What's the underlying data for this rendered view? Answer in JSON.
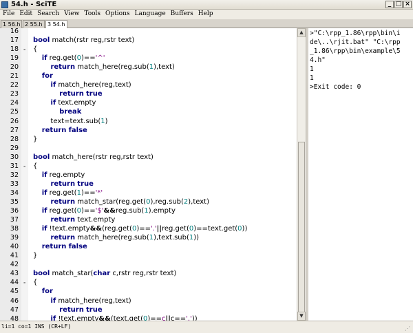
{
  "window": {
    "title": "54.h - SciTE",
    "min_glyph": "_",
    "max_glyph": "□",
    "close_glyph": "×"
  },
  "menu": [
    "File",
    "Edit",
    "Search",
    "View",
    "Tools",
    "Options",
    "Language",
    "Buffers",
    "Help"
  ],
  "tabs": [
    "1 56.h",
    "2 55.h",
    "3 54.h"
  ],
  "active_tab": 2,
  "editor": {
    "lines": [
      {
        "n": "16",
        "fold": "",
        "code": []
      },
      {
        "n": "17",
        "fold": "",
        "code": [
          [
            "kw",
            "bool"
          ],
          [
            "t",
            " match(rstr reg,rstr text)"
          ]
        ]
      },
      {
        "n": "18",
        "fold": "-",
        "code": [
          [
            "t",
            "{"
          ]
        ]
      },
      {
        "n": "19",
        "fold": "",
        "code": [
          [
            "t",
            "    "
          ],
          [
            "kw",
            "if"
          ],
          [
            "t",
            " reg.get("
          ],
          [
            "num",
            "0"
          ],
          [
            "t",
            ")=="
          ],
          [
            "str",
            "'^'"
          ]
        ]
      },
      {
        "n": "20",
        "fold": "",
        "code": [
          [
            "t",
            "        "
          ],
          [
            "kw",
            "return"
          ],
          [
            "t",
            " match_here(reg.sub("
          ],
          [
            "num",
            "1"
          ],
          [
            "t",
            "),text)"
          ]
        ]
      },
      {
        "n": "21",
        "fold": "",
        "code": [
          [
            "t",
            "    "
          ],
          [
            "kw",
            "for"
          ]
        ]
      },
      {
        "n": "22",
        "fold": "",
        "code": [
          [
            "t",
            "        "
          ],
          [
            "kw",
            "if"
          ],
          [
            "t",
            " match_here(reg,text)"
          ]
        ]
      },
      {
        "n": "23",
        "fold": "",
        "code": [
          [
            "t",
            "            "
          ],
          [
            "kw",
            "return"
          ],
          [
            "t",
            " "
          ],
          [
            "kw",
            "true"
          ]
        ]
      },
      {
        "n": "24",
        "fold": "",
        "code": [
          [
            "t",
            "        "
          ],
          [
            "kw",
            "if"
          ],
          [
            "t",
            " text.empty"
          ]
        ]
      },
      {
        "n": "25",
        "fold": "",
        "code": [
          [
            "t",
            "            "
          ],
          [
            "kw",
            "break"
          ]
        ]
      },
      {
        "n": "26",
        "fold": "",
        "code": [
          [
            "t",
            "        text=text.sub("
          ],
          [
            "num",
            "1"
          ],
          [
            "t",
            ")"
          ]
        ]
      },
      {
        "n": "27",
        "fold": "",
        "code": [
          [
            "t",
            "    "
          ],
          [
            "kw",
            "return"
          ],
          [
            "t",
            " "
          ],
          [
            "kw",
            "false"
          ]
        ]
      },
      {
        "n": "28",
        "fold": "",
        "code": [
          [
            "t",
            "}"
          ]
        ]
      },
      {
        "n": "29",
        "fold": "",
        "code": []
      },
      {
        "n": "30",
        "fold": "",
        "code": [
          [
            "kw",
            "bool"
          ],
          [
            "t",
            " match_here(rstr reg,rstr text)"
          ]
        ]
      },
      {
        "n": "31",
        "fold": "-",
        "code": [
          [
            "t",
            "{"
          ]
        ]
      },
      {
        "n": "32",
        "fold": "",
        "code": [
          [
            "t",
            "    "
          ],
          [
            "kw",
            "if"
          ],
          [
            "t",
            " reg.empty"
          ]
        ]
      },
      {
        "n": "33",
        "fold": "",
        "code": [
          [
            "t",
            "        "
          ],
          [
            "kw",
            "return"
          ],
          [
            "t",
            " "
          ],
          [
            "kw",
            "true"
          ]
        ]
      },
      {
        "n": "34",
        "fold": "",
        "code": [
          [
            "t",
            "    "
          ],
          [
            "kw",
            "if"
          ],
          [
            "t",
            " reg.get("
          ],
          [
            "num",
            "1"
          ],
          [
            "t",
            ")=="
          ],
          [
            "str",
            "'*'"
          ]
        ]
      },
      {
        "n": "35",
        "fold": "",
        "code": [
          [
            "t",
            "        "
          ],
          [
            "kw",
            "return"
          ],
          [
            "t",
            " match_star(reg.get("
          ],
          [
            "num",
            "0"
          ],
          [
            "t",
            "),reg.sub("
          ],
          [
            "num",
            "2"
          ],
          [
            "t",
            "),text)"
          ]
        ]
      },
      {
        "n": "36",
        "fold": "",
        "code": [
          [
            "t",
            "    "
          ],
          [
            "kw",
            "if"
          ],
          [
            "t",
            " reg.get("
          ],
          [
            "num",
            "0"
          ],
          [
            "t",
            ")=="
          ],
          [
            "str",
            "'$'"
          ],
          [
            "op",
            "&&"
          ],
          [
            "t",
            "reg.sub("
          ],
          [
            "num",
            "1"
          ],
          [
            "t",
            ").empty"
          ]
        ]
      },
      {
        "n": "37",
        "fold": "",
        "code": [
          [
            "t",
            "        "
          ],
          [
            "kw",
            "return"
          ],
          [
            "t",
            " text.empty"
          ]
        ]
      },
      {
        "n": "38",
        "fold": "",
        "code": [
          [
            "t",
            "    "
          ],
          [
            "kw",
            "if"
          ],
          [
            "t",
            " !text.empty"
          ],
          [
            "op",
            "&&"
          ],
          [
            "t",
            "(reg.get("
          ],
          [
            "num",
            "0"
          ],
          [
            "t",
            ")=="
          ],
          [
            "str",
            "'.'"
          ],
          [
            "op",
            "||"
          ],
          [
            "t",
            "reg.get("
          ],
          [
            "num",
            "0"
          ],
          [
            "t",
            ")==text.get("
          ],
          [
            "num",
            "0"
          ],
          [
            "t",
            "))"
          ]
        ]
      },
      {
        "n": "39",
        "fold": "",
        "code": [
          [
            "t",
            "        "
          ],
          [
            "kw",
            "return"
          ],
          [
            "t",
            " match_here(reg.sub("
          ],
          [
            "num",
            "1"
          ],
          [
            "t",
            "),text.sub("
          ],
          [
            "num",
            "1"
          ],
          [
            "t",
            "))"
          ]
        ]
      },
      {
        "n": "40",
        "fold": "",
        "code": [
          [
            "t",
            "    "
          ],
          [
            "kw",
            "return"
          ],
          [
            "t",
            " "
          ],
          [
            "kw",
            "false"
          ]
        ]
      },
      {
        "n": "41",
        "fold": "",
        "code": [
          [
            "t",
            "}"
          ]
        ]
      },
      {
        "n": "42",
        "fold": "",
        "code": []
      },
      {
        "n": "43",
        "fold": "",
        "code": [
          [
            "kw",
            "bool"
          ],
          [
            "t",
            " match_star("
          ],
          [
            "kw",
            "char"
          ],
          [
            "t",
            " c,rstr reg,rstr text)"
          ]
        ]
      },
      {
        "n": "44",
        "fold": "-",
        "code": [
          [
            "t",
            "{"
          ]
        ]
      },
      {
        "n": "45",
        "fold": "",
        "code": [
          [
            "t",
            "    "
          ],
          [
            "kw",
            "for"
          ]
        ]
      },
      {
        "n": "46",
        "fold": "",
        "code": [
          [
            "t",
            "        "
          ],
          [
            "kw",
            "if"
          ],
          [
            "t",
            " match_here(reg,text)"
          ]
        ]
      },
      {
        "n": "47",
        "fold": "",
        "code": [
          [
            "t",
            "            "
          ],
          [
            "kw",
            "return"
          ],
          [
            "t",
            " "
          ],
          [
            "kw",
            "true"
          ]
        ]
      },
      {
        "n": "48",
        "fold": "",
        "code": [
          [
            "t",
            "        "
          ],
          [
            "kw",
            "if"
          ],
          [
            "t",
            " !text.empty"
          ],
          [
            "op",
            "&&"
          ],
          [
            "t",
            "(text.get("
          ],
          [
            "num",
            "0"
          ],
          [
            "t",
            ")=="
          ],
          [
            "str",
            "c"
          ],
          [
            "op",
            "||"
          ],
          [
            "t",
            "c=="
          ],
          [
            "str",
            "'.'"
          ],
          [
            "t",
            "))"
          ]
        ]
      }
    ]
  },
  "output": {
    "lines": [
      ">\"C:\\rpp_1.86\\rpp\\bin\\i",
      "de\\..\\rjit.bat\" \"C:\\rpp",
      "_1.86\\rpp\\bin\\example\\5",
      "4.h\"",
      "1",
      "1",
      ">Exit code: 0"
    ]
  },
  "status": {
    "text": "li=1 co=1 INS (CR+LF)"
  }
}
